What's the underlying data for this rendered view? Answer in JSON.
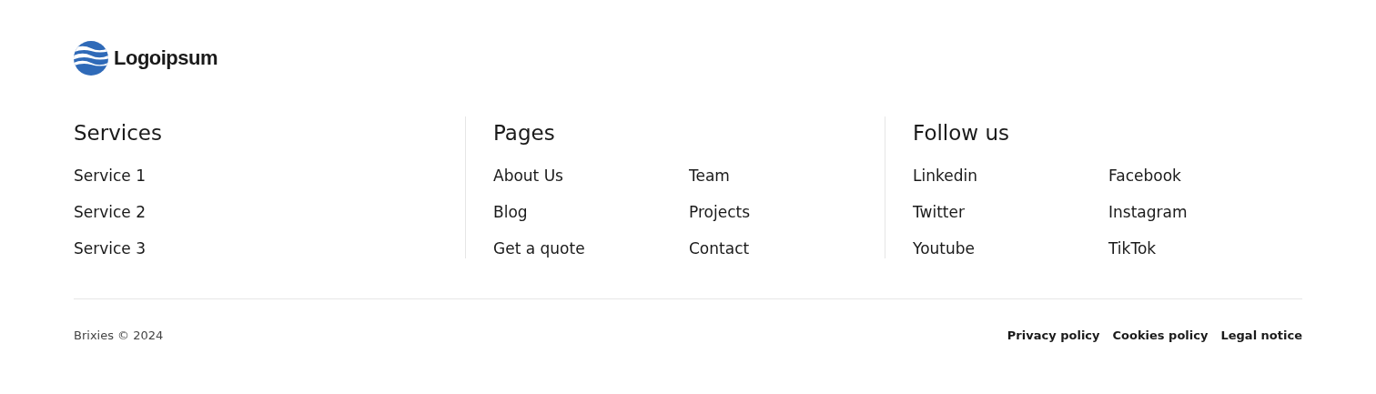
{
  "logo": {
    "name": "Logoipsum"
  },
  "columns": [
    {
      "title": "Services",
      "links": [
        [
          "Service 1",
          "Service 2",
          "Service 3"
        ]
      ]
    },
    {
      "title": "Pages",
      "links": [
        [
          "About Us",
          "Blog",
          "Get a quote"
        ],
        [
          "Team",
          "Projects",
          "Contact"
        ]
      ]
    },
    {
      "title": "Follow us",
      "links": [
        [
          "Linkedin",
          "Twitter",
          "Youtube"
        ],
        [
          "Facebook",
          "Instagram",
          "TikTok"
        ]
      ]
    }
  ],
  "copyright": "Brixies © 2024",
  "legal_links": [
    "Privacy policy",
    "Cookies policy",
    "Legal notice"
  ]
}
